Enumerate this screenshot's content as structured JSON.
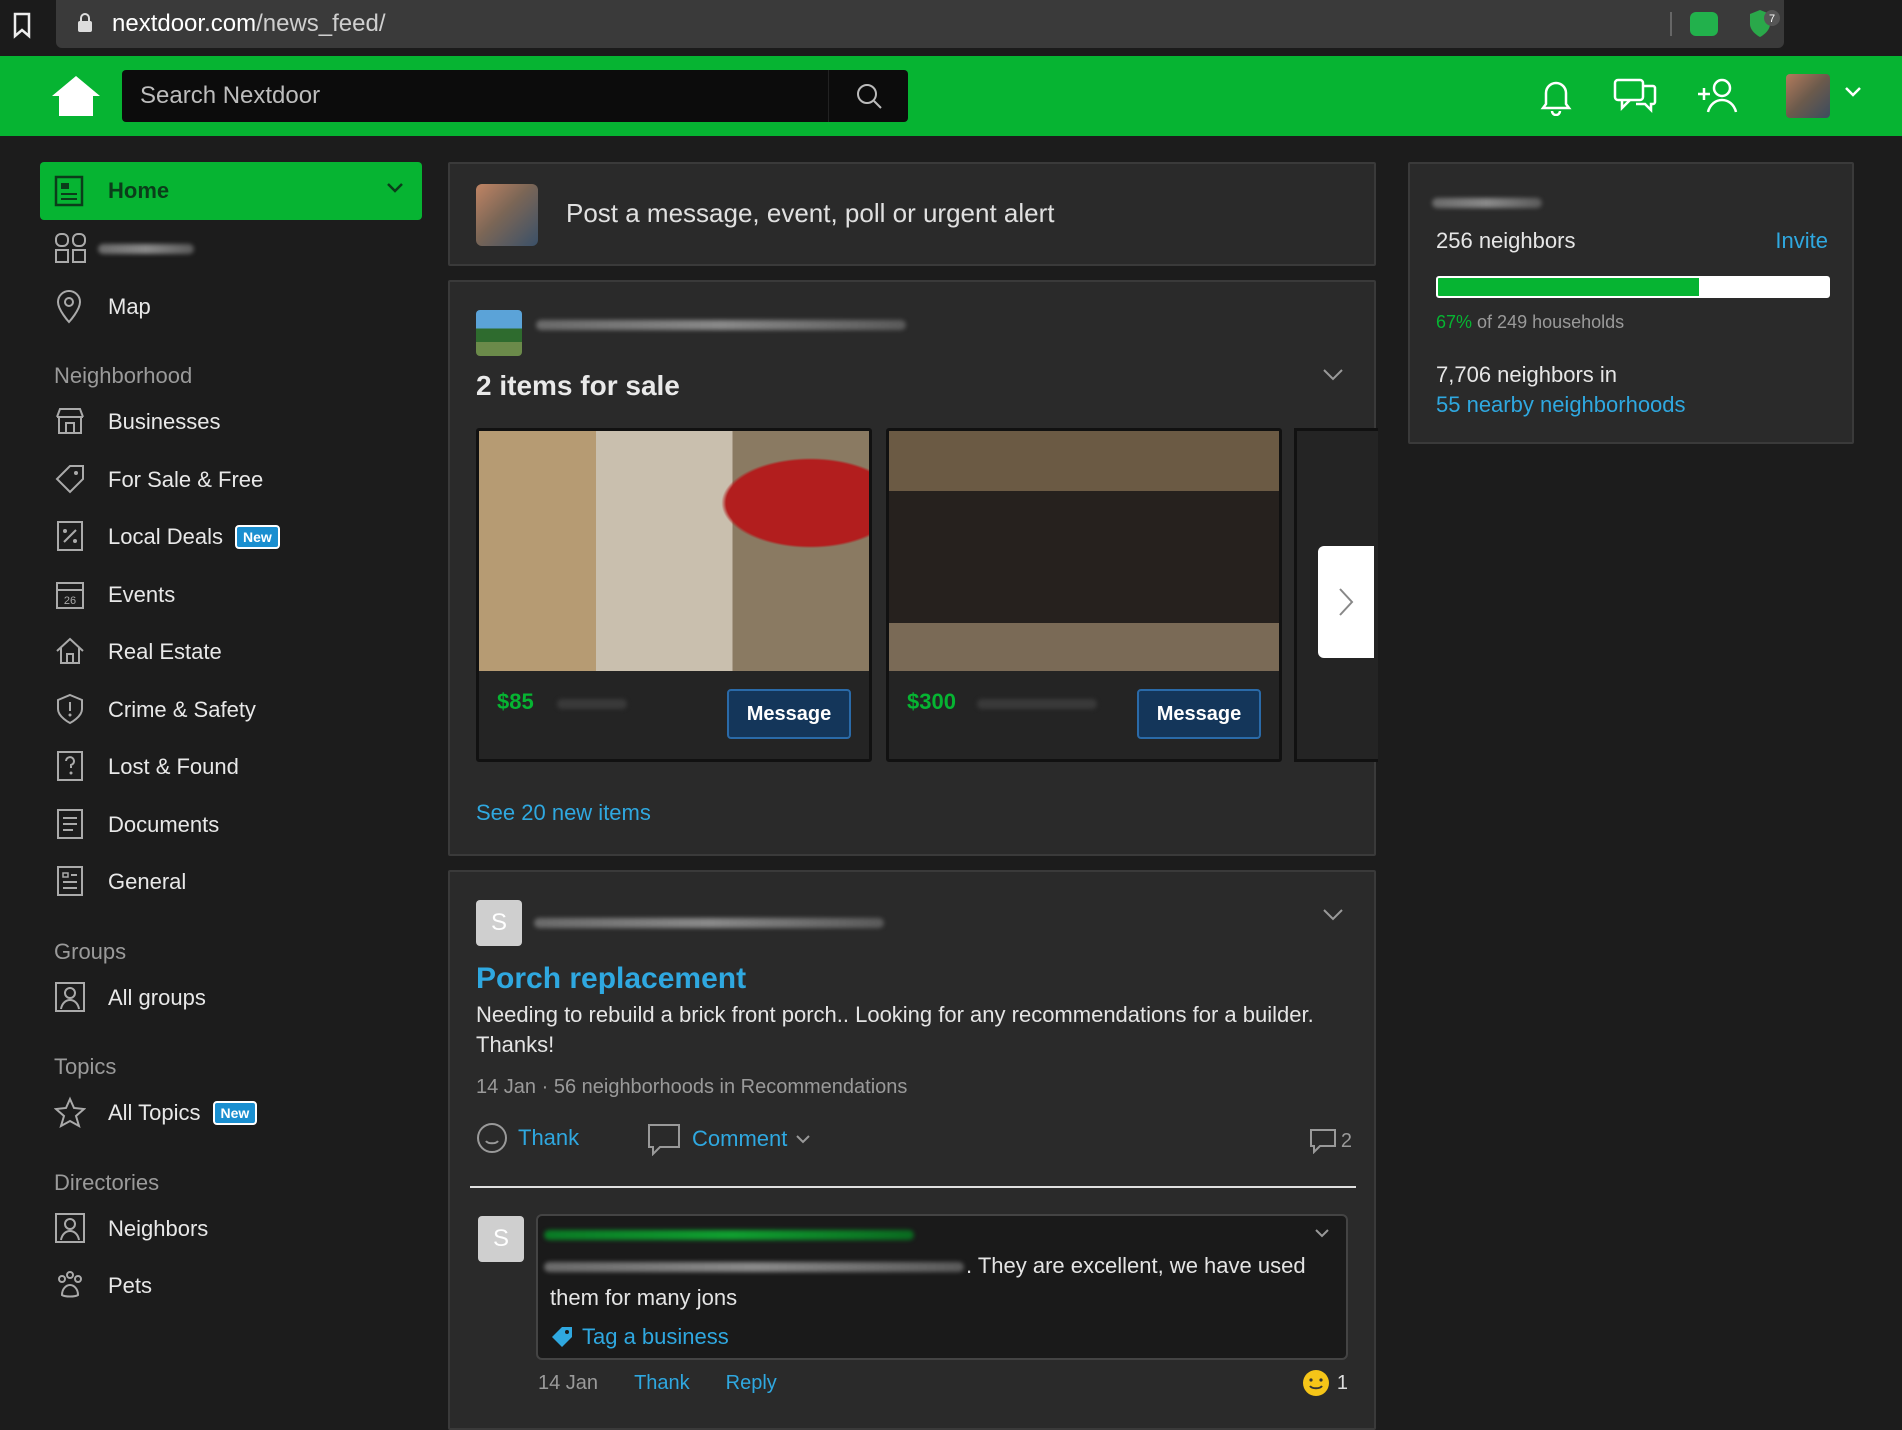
{
  "browser": {
    "url_host": "nextdoor.com",
    "url_path": "/news_feed/",
    "ext_badge": "7"
  },
  "header": {
    "search_placeholder": "Search Nextdoor"
  },
  "sidebar": {
    "home": "Home",
    "map": "Map",
    "neighborhood_heading": "Neighborhood",
    "neighborhood_items": [
      {
        "label": "Businesses",
        "icon": "storefront-icon"
      },
      {
        "label": "For Sale & Free",
        "icon": "tag-icon"
      },
      {
        "label": "Local Deals",
        "icon": "percent-coupon-icon",
        "badge": "New"
      },
      {
        "label": "Events",
        "icon": "calendar-icon"
      },
      {
        "label": "Real Estate",
        "icon": "house-icon"
      },
      {
        "label": "Crime & Safety",
        "icon": "alert-shield-icon"
      },
      {
        "label": "Lost & Found",
        "icon": "question-doc-icon"
      },
      {
        "label": "Documents",
        "icon": "document-icon"
      },
      {
        "label": "General",
        "icon": "list-doc-icon"
      }
    ],
    "groups_heading": "Groups",
    "all_groups": "All groups",
    "topics_heading": "Topics",
    "all_topics": "All Topics",
    "all_topics_badge": "New",
    "directories_heading": "Directories",
    "neighbors": "Neighbors",
    "pets": "Pets",
    "calendar_day": "26"
  },
  "composer": {
    "prompt": "Post a message, event, poll or urgent alert"
  },
  "sale": {
    "title": "2 items for sale",
    "items": [
      {
        "price": "$85",
        "button": "Message"
      },
      {
        "price": "$300",
        "button": "Message"
      }
    ],
    "see_more": "See 20 new items"
  },
  "post": {
    "avatar_letter": "S",
    "title": "Porch replacement",
    "body": "Needing to rebuild a brick front porch.. Looking for any recommendations for a builder. Thanks!",
    "meta": "14 Jan · 56 neighborhoods in Recommendations",
    "thank": "Thank",
    "comment": "Comment",
    "comment_count": "2",
    "reply": {
      "avatar_letter": "S",
      "text": ". They are excellent, we have used them for many jons",
      "tag": "Tag a business",
      "date": "14 Jan",
      "thank": "Thank",
      "reply": "Reply",
      "reactions": "1"
    }
  },
  "stats": {
    "neighbors": "256 neighbors",
    "invite": "Invite",
    "progress": 0.67,
    "pct": "67%",
    "households": " of 249 households",
    "nearby_prefix": "7,706 neighbors in",
    "nearby_link": "55 nearby neighborhoods"
  },
  "colors": {
    "brand": "#06b432",
    "link": "#2fa8e0"
  }
}
